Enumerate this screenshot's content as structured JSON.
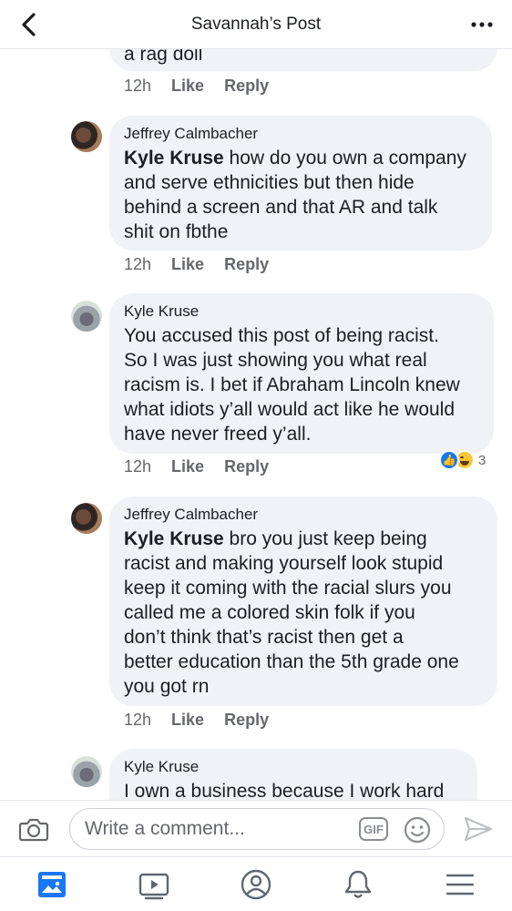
{
  "header": {
    "title": "Savannah’s Post"
  },
  "comments": [
    {
      "text": "a rag doll",
      "time": "12h",
      "like_label": "Like",
      "reply_label": "Reply"
    },
    {
      "author": "Jeffrey Calmbacher",
      "mention": "Kyle Kruse",
      "text": " how do you own a company\nand serve ethnicities but then hide\nbehind a screen and that AR and talk\nshit on fbthe",
      "time": "12h",
      "like_label": "Like",
      "reply_label": "Reply"
    },
    {
      "author": "Kyle Kruse",
      "text": "You accused this post of being racist.\nSo I was just showing you what real\nracism is. I bet if Abraham Lincoln knew\nwhat idiots y’all would act like he would\nhave never freed y’all.",
      "time": "12h",
      "like_label": "Like",
      "reply_label": "Reply",
      "reactions": {
        "types": [
          "like",
          "haha"
        ],
        "count": "3"
      }
    },
    {
      "author": "Jeffrey Calmbacher",
      "mention": "Kyle Kruse",
      "text": "  bro you just keep being\nracist and making yourself look stupid\nkeep it coming with the racial slurs you\ncalled me a colored skin folk if you\ndon’t think that’s racist then get a\nbetter education than the 5th grade one\nyou got rn",
      "time": "12h",
      "like_label": "Like",
      "reply_label": "Reply"
    },
    {
      "author": "Kyle Kruse",
      "text": "I own a business because I work hard"
    }
  ],
  "composer": {
    "placeholder": "Write a comment...",
    "gif_label": "GIF"
  },
  "icons": {
    "back": "chevron-left-icon",
    "more": "more-dots-icon",
    "camera": "camera-icon",
    "emoji": "emoji-icon",
    "send": "send-icon",
    "nav": [
      "news-feed-icon",
      "watch-icon",
      "profile-icon",
      "notifications-icon",
      "menu-icon"
    ]
  },
  "colors": {
    "accent": "#1877f2",
    "bubble": "#f0f2f5",
    "secondary_text": "#65676b"
  }
}
